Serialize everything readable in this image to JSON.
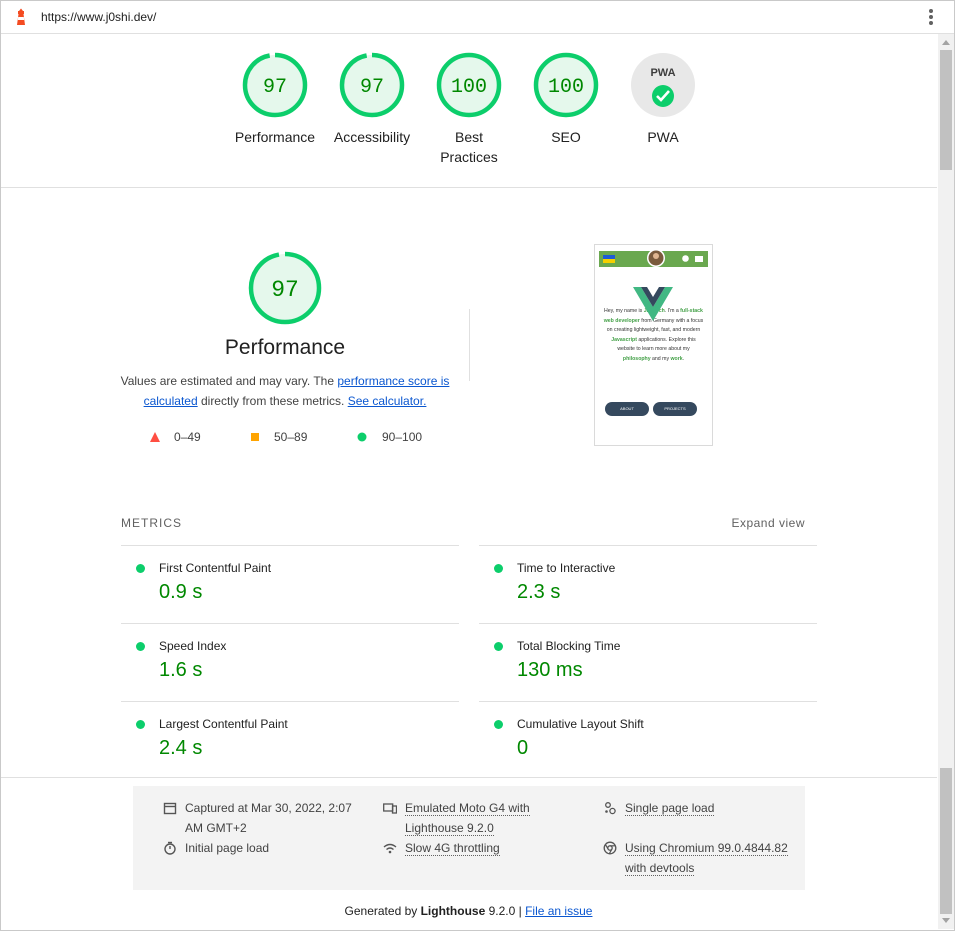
{
  "browser": {
    "url": "https://www.j0shi.dev/"
  },
  "colors": {
    "pass": "#0cce6b",
    "pass_text": "#008800",
    "pass_fill": "#e5f8ec",
    "fail": "#ff4e42",
    "average": "#ffa400",
    "pwa_bg": "#e8e8e8"
  },
  "categories": [
    {
      "score": "97",
      "label": "Performance",
      "value": 0.97
    },
    {
      "score": "97",
      "label": "Accessibility",
      "value": 0.97
    },
    {
      "score": "100",
      "label": "Best Practices",
      "value": 1.0
    },
    {
      "score": "100",
      "label": "SEO",
      "value": 1.0
    },
    {
      "badge": "PWA",
      "label": "PWA",
      "icon": "check-icon"
    }
  ],
  "performance": {
    "score": "97",
    "value": 0.97,
    "title": "Performance",
    "desc_prefix": "Values are estimated and may vary. The ",
    "link_score": "performance score is calculated",
    "desc_middle": " directly from these metrics. ",
    "link_calc": "See calculator."
  },
  "legend": [
    {
      "icon": "triangle-icon",
      "label": "0–49"
    },
    {
      "icon": "square-icon",
      "label": "50–89"
    },
    {
      "icon": "circle-icon",
      "label": "90–100"
    }
  ],
  "screenshot": {
    "text_parts": [
      "Hey, my name is ",
      "Janosch",
      ". I'm a ",
      "full-stack web developer",
      " from Germany with a focus on creating lightweight, fast, and modern ",
      "Javascript",
      " applications. Explore this website to learn more about my ",
      "philosophy",
      " and my ",
      "work",
      "."
    ],
    "btn_about": "ABOUT",
    "btn_projects": "PROJECTS"
  },
  "metrics": {
    "heading": "METRICS",
    "expand": "Expand view",
    "items": [
      {
        "title": "First Contentful Paint",
        "value": "0.9 s"
      },
      {
        "title": "Time to Interactive",
        "value": "2.3 s"
      },
      {
        "title": "Speed Index",
        "value": "1.6 s"
      },
      {
        "title": "Total Blocking Time",
        "value": "130 ms"
      },
      {
        "title": "Largest Contentful Paint",
        "value": "2.4 s"
      },
      {
        "title": "Cumulative Layout Shift",
        "value": "0"
      }
    ]
  },
  "runtime": {
    "captured_1": "Captured at Mar 30, 2022, 2:07",
    "captured_2": "AM GMT+2",
    "initial": "Initial page load",
    "emulated_1": "Emulated Moto G4 with",
    "emulated_2": "Lighthouse 9.2.0",
    "throttling": "Slow 4G throttling",
    "single": "Single page load",
    "chromium_1": "Using Chromium 99.0.4844.82",
    "chromium_2": "with devtools"
  },
  "footer": {
    "prefix": "Generated by ",
    "brand": "Lighthouse",
    "version": " 9.2.0 | ",
    "link": "File an issue"
  }
}
